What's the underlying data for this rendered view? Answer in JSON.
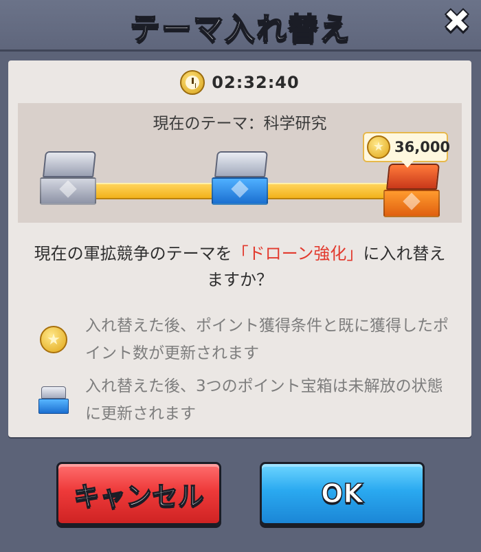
{
  "header": {
    "title": "テーマ入れ替え",
    "close_icon": "close-icon"
  },
  "timer": {
    "icon": "clock-icon",
    "value": "02:32:40"
  },
  "theme": {
    "current_label": "現在のテーマ：科学研究",
    "chests": [
      {
        "type": "silver",
        "icon": "silver-chest-icon"
      },
      {
        "type": "blue",
        "icon": "blue-chest-icon"
      },
      {
        "type": "orange",
        "icon": "orange-chest-icon"
      }
    ],
    "price": {
      "icon": "coin-icon",
      "value": "36,000"
    }
  },
  "question": {
    "prefix": "現在の軍拡競争のテーマを",
    "highlight": "「ドローン強化」",
    "suffix": "に入れ替えますか？"
  },
  "notes": [
    {
      "icon": "coin-icon",
      "text": "入れ替えた後、ポイント獲得条件と既に獲得したポイント数が更新されます"
    },
    {
      "icon": "blue-chest-icon",
      "text": "入れ替えた後、3つのポイント宝箱は未解放の状態に更新されます"
    }
  ],
  "buttons": {
    "cancel_label": "キャンセル",
    "ok_label": "OK"
  },
  "colors": {
    "highlight": "#e23a2e",
    "cancel": "#ee3a3a",
    "ok": "#2aa9f0",
    "track": "#f2b21b"
  }
}
